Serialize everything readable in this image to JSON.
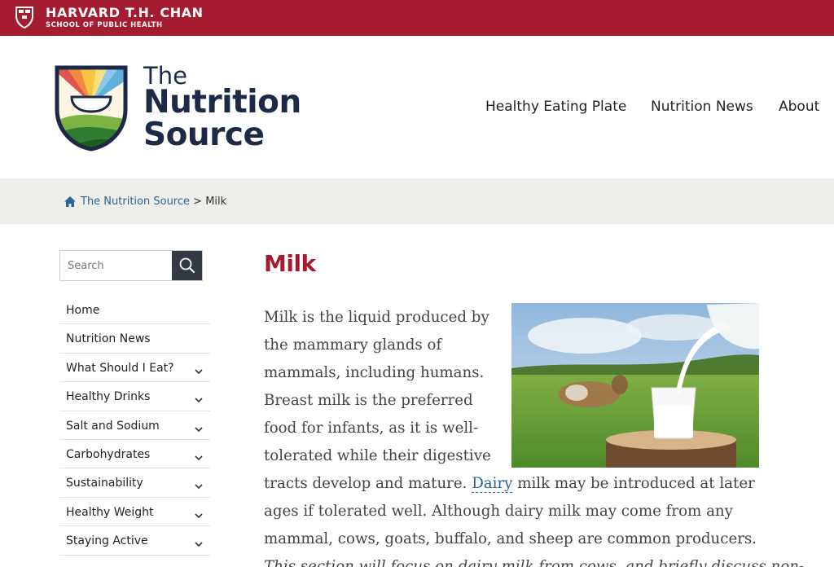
{
  "harvard_bar": {
    "name": "HARVARD T.H. CHAN",
    "subtitle": "SCHOOL OF PUBLIC HEALTH",
    "brand_color": "#a51c30",
    "icon": "harvard-shield-icon"
  },
  "logo": {
    "line1": "The",
    "line2": "Nutrition",
    "line3": "Source",
    "text_color": "#1d2a47",
    "icon": "nutrition-source-shield-icon"
  },
  "main_nav": [
    {
      "label": "Healthy Eating Plate"
    },
    {
      "label": "Nutrition News"
    },
    {
      "label": "About"
    }
  ],
  "breadcrumb": {
    "icon": "home-icon",
    "home_label": "The Nutrition Source",
    "separator": ">",
    "current": "Milk",
    "link_color": "#2a6496"
  },
  "search": {
    "placeholder": "Search",
    "value": "",
    "button_icon": "search-icon"
  },
  "sidebar": {
    "items": [
      {
        "label": "Home",
        "expandable": false
      },
      {
        "label": "Nutrition News",
        "expandable": false
      },
      {
        "label": "What Should I Eat?",
        "expandable": true
      },
      {
        "label": "Healthy Drinks",
        "expandable": true
      },
      {
        "label": "Salt and Sodium",
        "expandable": true
      },
      {
        "label": "Carbohydrates",
        "expandable": true
      },
      {
        "label": "Sustainability",
        "expandable": true
      },
      {
        "label": "Healthy Weight",
        "expandable": true
      },
      {
        "label": "Staying Active",
        "expandable": true
      }
    ]
  },
  "article": {
    "title": "Milk",
    "title_color": "#a51c30",
    "image_subject": "milk-pouring-into-glass-with-cow-in-meadow",
    "lines": [
      "Milk is the liquid produced by",
      "the mammary glands of",
      "mammals, including humans.",
      "Breast milk is the preferred",
      "food for infants, as it is well-",
      "tolerated while their digestive"
    ],
    "line7_before": "tracts develop and mature. ",
    "link_text": "Dairy",
    "line7_after": " milk may be introduced at later",
    "line8": "ages if tolerated well. Although dairy milk may come from any",
    "line9": "mammal, cows, goats, buffalo, and sheep are common producers.",
    "line10_italic": "This section will focus on dairy milk from cows, and briefly discuss non-"
  }
}
